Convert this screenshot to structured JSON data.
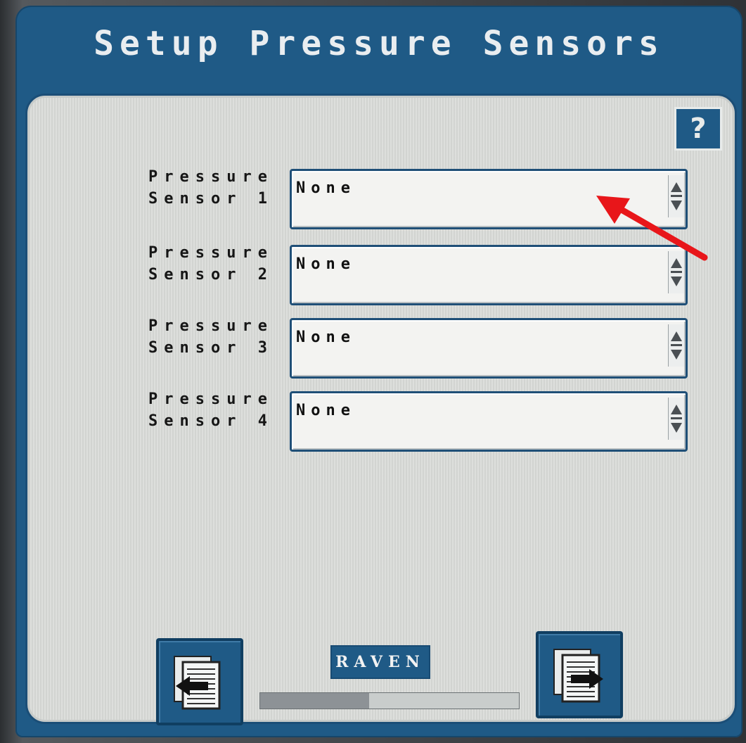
{
  "window": {
    "title": "Setup Pressure Sensors"
  },
  "help_button": {
    "label": "?"
  },
  "sensors": [
    {
      "label": "Pressure\nSensor 1",
      "value": "None"
    },
    {
      "label": "Pressure\nSensor 2",
      "value": "None"
    },
    {
      "label": "Pressure\nSensor 3",
      "value": "None"
    },
    {
      "label": "Pressure\nSensor 4",
      "value": "None"
    }
  ],
  "footer": {
    "brand": "RAVEN",
    "progress_fraction": 0.42
  },
  "icons": {
    "back": "page-back-arrow-icon",
    "next": "page-next-arrow-icon",
    "spinner": "up-down-spinner-icon",
    "annotation": "red-arrow-annotation"
  },
  "colors": {
    "frame_blue": "#1f5a86",
    "panel_gray": "#d9dbd8",
    "annotation_red": "#e8161a"
  }
}
